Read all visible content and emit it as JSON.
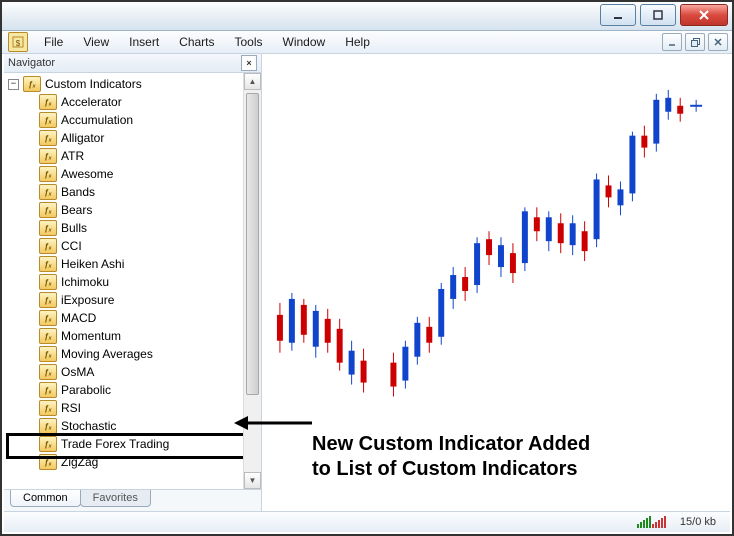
{
  "menu": {
    "items": [
      "File",
      "View",
      "Insert",
      "Charts",
      "Tools",
      "Window",
      "Help"
    ]
  },
  "navigator": {
    "title": "Navigator",
    "root_label": "Custom Indicators",
    "items": [
      "Accelerator",
      "Accumulation",
      "Alligator",
      "ATR",
      "Awesome",
      "Bands",
      "Bears",
      "Bulls",
      "CCI",
      "Heiken Ashi",
      "Ichimoku",
      "iExposure",
      "MACD",
      "Momentum",
      "Moving Averages",
      "OsMA",
      "Parabolic",
      "RSI",
      "Stochastic",
      "Trade Forex Trading",
      "ZigZag"
    ],
    "highlighted_index": 19,
    "tabs": {
      "active": "Common",
      "inactive": "Favorites"
    }
  },
  "annotation": {
    "line1": "New Custom Indicator Added",
    "line2": "to List of Custom Indicators"
  },
  "status": {
    "transfer": "15/0 kb"
  }
}
